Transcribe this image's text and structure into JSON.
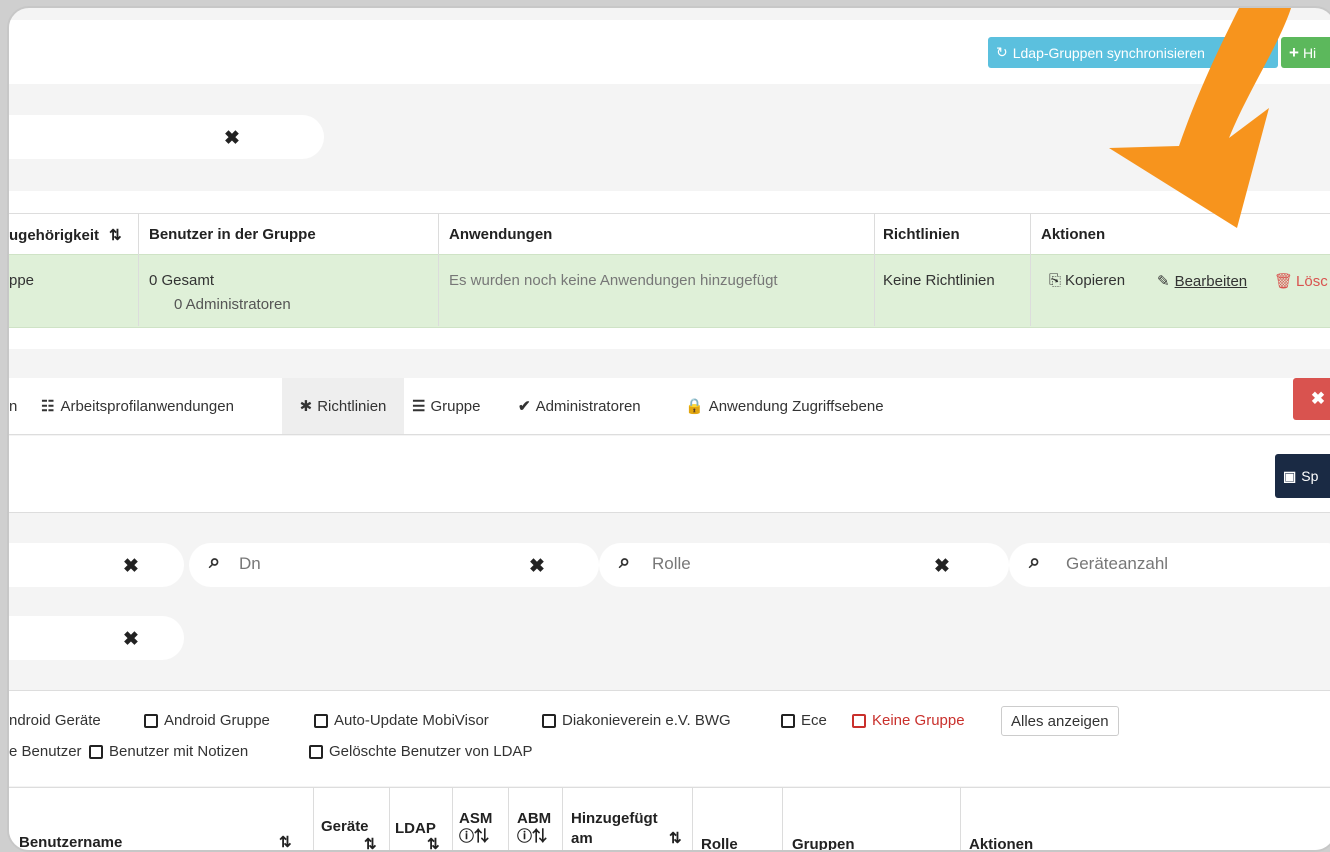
{
  "toolbar": {
    "ldap_sync_label": "Ldap-Gruppen synchronisieren",
    "add_label": "Hi"
  },
  "group_table": {
    "headers": {
      "zugehoerigkeit": "ugehörigkeit",
      "benutzer": "Benutzer in der Gruppe",
      "anwendungen": "Anwendungen",
      "richtlinien": "Richtlinien",
      "aktionen": "Aktionen"
    },
    "row": {
      "zugehoerigkeit": "ppe",
      "gesamt": "0 Gesamt",
      "admins": "0 Administratoren",
      "anwendungen": "Es wurden noch keine Anwendungen hinzugefügt",
      "richtlinien": "Keine Richtlinien",
      "kopieren": "Kopieren",
      "bearbeiten": "Bearbeiten",
      "loeschen": "Lösc"
    }
  },
  "tabs": [
    {
      "label": "n"
    },
    {
      "label": "Arbeitsprofilanwendungen",
      "icon": "grid-icon"
    },
    {
      "label": "Richtlinien",
      "icon": "asterisk-icon"
    },
    {
      "label": "Gruppe",
      "icon": "list-icon"
    },
    {
      "label": "Administratoren",
      "icon": "chevron-down-icon"
    },
    {
      "label": "Anwendung Zugriffsebene",
      "icon": "lock-icon"
    }
  ],
  "save_label": "Sp",
  "search": {
    "dn_placeholder": "Dn",
    "rolle_placeholder": "Rolle",
    "geraete_placeholder": "Geräteanzahl"
  },
  "filters_row1": [
    "ndroid Geräte",
    "Android Gruppe",
    "Auto-Update MobiVisor",
    "Diakonieverein e.V. BWG",
    "Ece",
    "Keine Gruppe"
  ],
  "show_all_label": "Alles anzeigen",
  "filters_row2": [
    "e Benutzer",
    "Benutzer mit Notizen",
    "Gelöschte Benutzer von LDAP"
  ],
  "user_table_headers": {
    "benutzername": "Benutzername",
    "geraete": "Geräte",
    "ldap": "LDAP",
    "asm": "ASM",
    "abm": "ABM",
    "hinzugefuegt": "Hinzugefügt",
    "am": "am",
    "rolle": "Rolle",
    "gruppen": "Gruppen",
    "aktionen": "Aktionen"
  },
  "colors": {
    "ldap_button": "#5bc0de",
    "add_button": "#5cb85c",
    "row_highlight": "#dff0d8",
    "delete": "#d9534f",
    "save": "#1a2a44",
    "arrow": "#f7941d"
  }
}
